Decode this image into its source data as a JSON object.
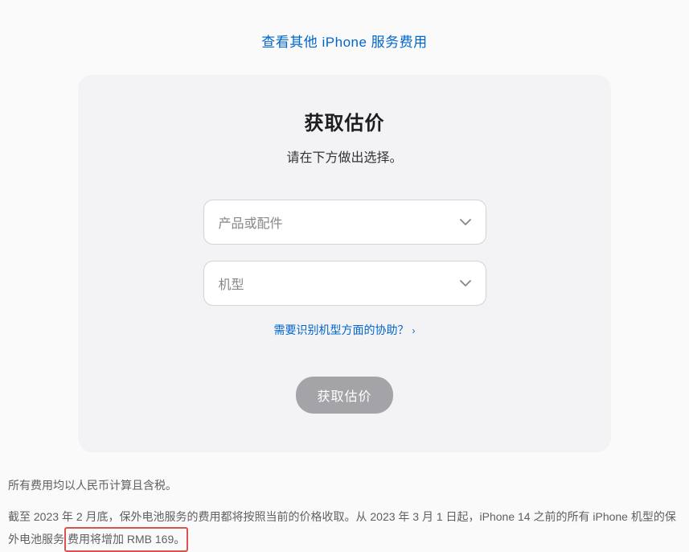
{
  "topLink": {
    "label": "查看其他 iPhone 服务费用"
  },
  "card": {
    "title": "获取估价",
    "subtitle": "请在下方做出选择。",
    "select1": {
      "placeholder": "产品或配件"
    },
    "select2": {
      "placeholder": "机型"
    },
    "helpLink": {
      "label": "需要识别机型方面的协助？"
    },
    "submit": {
      "label": "获取估价"
    }
  },
  "footer": {
    "line1": "所有费用均以人民币计算且含税。",
    "line2_pre": "截至 2023 年 2 月底，保外电池服务的费用都将按照当前的价格收取。从 2023 年 3 月 1 日起，iPhone 14 之前的所有 iPhone 机型的保外电池服务",
    "line2_highlight": "费用将增加 RMB 169。"
  }
}
